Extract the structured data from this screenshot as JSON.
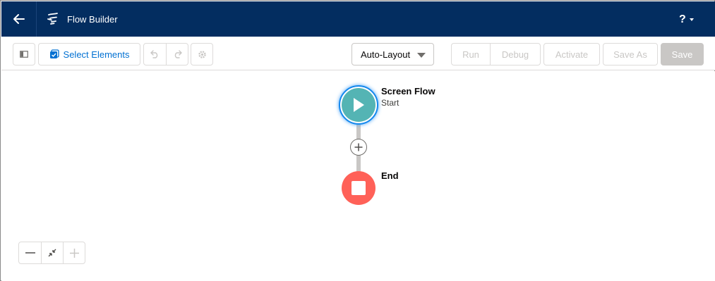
{
  "header": {
    "title": "Flow Builder",
    "back_icon": "arrow-left-icon",
    "logo_icon": "flow-icon",
    "help_label": "?"
  },
  "toolbar": {
    "select_elements_label": "Select Elements",
    "layout_value": "Auto-Layout",
    "run_label": "Run",
    "debug_label": "Debug",
    "activate_label": "Activate",
    "save_as_label": "Save As",
    "save_label": "Save"
  },
  "canvas": {
    "start_node": {
      "title": "Screen Flow",
      "subtitle": "Start"
    },
    "end_node": {
      "title": "End"
    }
  },
  "colors": {
    "header_bg": "#032d60",
    "start_node": "#54b4b4",
    "end_node": "#ff6158",
    "link": "#0070d2",
    "disabled": "#c9c7c5"
  }
}
